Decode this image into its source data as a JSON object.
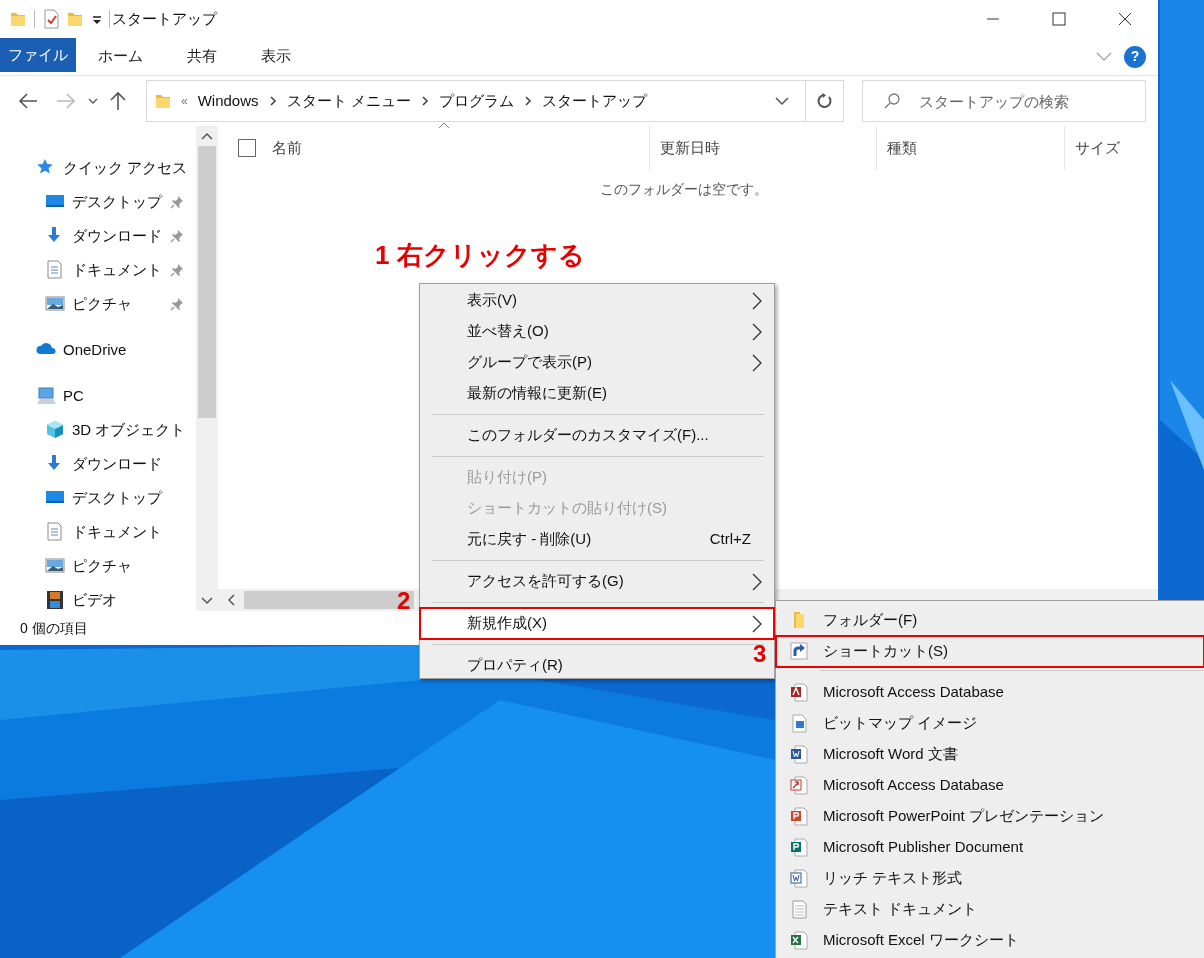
{
  "window": {
    "title": "スタートアップ"
  },
  "ribbon": {
    "tabs": [
      {
        "label": "ファイル",
        "kind": "file"
      },
      {
        "label": "ホーム",
        "kind": "tab"
      },
      {
        "label": "共有",
        "kind": "tab"
      },
      {
        "label": "表示",
        "kind": "tab"
      }
    ],
    "help": "?"
  },
  "address_bar": {
    "overflow": "«",
    "path": [
      "Windows",
      "スタート メニュー",
      "プログラム",
      "スタートアップ"
    ]
  },
  "search": {
    "placeholder": "スタートアップの検索"
  },
  "select_all": {
    "checked": false
  },
  "columns": [
    "名前",
    "更新日時",
    "種類",
    "サイズ"
  ],
  "empty_message": "このフォルダーは空です。",
  "sidebar": {
    "items": [
      {
        "label": "クイック アクセス",
        "kind": "star",
        "children": [
          {
            "label": "デスクトップ",
            "kind": "desktop",
            "pinned": true
          },
          {
            "label": "ダウンロード",
            "kind": "download",
            "pinned": true
          },
          {
            "label": "ドキュメント",
            "kind": "document",
            "pinned": true
          },
          {
            "label": "ピクチャ",
            "kind": "pictures",
            "pinned": true
          }
        ]
      },
      {
        "label": "OneDrive",
        "kind": "cloud"
      },
      {
        "label": "PC",
        "kind": "pc",
        "children": [
          {
            "label": "3D オブジェクト",
            "kind": "cube",
            "pinned": false
          },
          {
            "label": "ダウンロード",
            "kind": "download",
            "pinned": false
          },
          {
            "label": "デスクトップ",
            "kind": "desktop",
            "pinned": false
          },
          {
            "label": "ドキュメント",
            "kind": "document",
            "pinned": false
          },
          {
            "label": "ピクチャ",
            "kind": "pictures",
            "pinned": false
          },
          {
            "label": "ビデオ",
            "kind": "video",
            "pinned": false
          }
        ]
      }
    ]
  },
  "status_bar": "0 個の項目",
  "annotations": [
    {
      "label": "1 右クリックする"
    },
    {
      "label": "2"
    },
    {
      "label": "3"
    }
  ],
  "context_menu": {
    "items": [
      {
        "kind": "item",
        "label": "表示(V)",
        "submenu": true,
        "disabled": false,
        "highlighted": false,
        "outlined": false
      },
      {
        "kind": "item",
        "label": "並べ替え(O)",
        "submenu": true,
        "disabled": false,
        "highlighted": false,
        "outlined": false
      },
      {
        "kind": "item",
        "label": "グループで表示(P)",
        "submenu": true,
        "disabled": false,
        "highlighted": false,
        "outlined": false
      },
      {
        "kind": "item",
        "label": "最新の情報に更新(E)",
        "submenu": false,
        "disabled": false,
        "highlighted": false,
        "outlined": false
      },
      {
        "kind": "separator"
      },
      {
        "kind": "item",
        "label": "このフォルダーのカスタマイズ(F)...",
        "submenu": false,
        "disabled": false,
        "highlighted": false,
        "outlined": false
      },
      {
        "kind": "separator"
      },
      {
        "kind": "item",
        "label": "貼り付け(P)",
        "submenu": false,
        "disabled": true,
        "highlighted": false,
        "outlined": false
      },
      {
        "kind": "item",
        "label": "ショートカットの貼り付け(S)",
        "submenu": false,
        "disabled": true,
        "highlighted": false,
        "outlined": false
      },
      {
        "kind": "item",
        "label": "元に戻す - 削除(U)",
        "shortcut": "Ctrl+Z",
        "submenu": false,
        "disabled": false,
        "highlighted": false,
        "outlined": false
      },
      {
        "kind": "separator"
      },
      {
        "kind": "item",
        "label": "アクセスを許可する(G)",
        "submenu": true,
        "disabled": false,
        "highlighted": false,
        "outlined": false
      },
      {
        "kind": "separator"
      },
      {
        "kind": "item",
        "label": "新規作成(X)",
        "submenu": true,
        "disabled": false,
        "highlighted": true,
        "outlined": true
      },
      {
        "kind": "separator"
      },
      {
        "kind": "item",
        "label": "プロパティ(R)",
        "submenu": false,
        "disabled": false,
        "highlighted": false,
        "outlined": false
      }
    ]
  },
  "submenu": {
    "items": [
      {
        "kind": "folder",
        "label": "フォルダー(F)",
        "outlined": false
      },
      {
        "kind": "shortcut",
        "label": "ショートカット(S)",
        "outlined": true
      },
      {
        "kind": "separator"
      },
      {
        "kind": "access",
        "label": "Microsoft Access Database",
        "outlined": false
      },
      {
        "kind": "bitmap",
        "label": "ビットマップ イメージ",
        "outlined": false
      },
      {
        "kind": "word",
        "label": "Microsoft Word 文書",
        "outlined": false
      },
      {
        "kind": "access2",
        "label": "Microsoft Access Database",
        "outlined": false
      },
      {
        "kind": "powerpoint",
        "label": "Microsoft PowerPoint プレゼンテーション",
        "outlined": false
      },
      {
        "kind": "publisher",
        "label": "Microsoft Publisher Document",
        "outlined": false
      },
      {
        "kind": "wordpad",
        "label": "リッチ テキスト形式",
        "outlined": false
      },
      {
        "kind": "text",
        "label": "テキスト ドキュメント",
        "outlined": false
      },
      {
        "kind": "excel",
        "label": "Microsoft Excel ワークシート",
        "outlined": false
      }
    ]
  }
}
